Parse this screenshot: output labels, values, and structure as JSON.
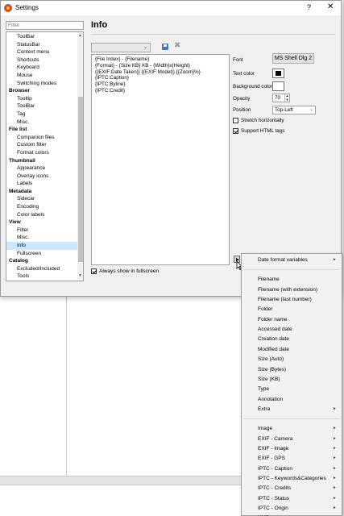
{
  "window": {
    "title": "Settings",
    "help_label": "?",
    "close_label": "✕"
  },
  "nav": {
    "filter_placeholder": "Filter",
    "items": [
      {
        "label": "ToolBar",
        "type": "sub"
      },
      {
        "label": "StatusBar",
        "type": "sub"
      },
      {
        "label": "Context menu",
        "type": "sub"
      },
      {
        "label": "Shortcuts",
        "type": "sub"
      },
      {
        "label": "Keyboard",
        "type": "sub"
      },
      {
        "label": "Mouse",
        "type": "sub"
      },
      {
        "label": "Switching modes",
        "type": "sub"
      },
      {
        "label": "Browser",
        "type": "cat"
      },
      {
        "label": "Tooltip",
        "type": "sub"
      },
      {
        "label": "ToolBar",
        "type": "sub"
      },
      {
        "label": "Tag",
        "type": "sub"
      },
      {
        "label": "Misc.",
        "type": "sub"
      },
      {
        "label": "File list",
        "type": "cat"
      },
      {
        "label": "Companion files",
        "type": "sub"
      },
      {
        "label": "Custom filter",
        "type": "sub"
      },
      {
        "label": "Format colors",
        "type": "sub"
      },
      {
        "label": "Thumbnail",
        "type": "cat"
      },
      {
        "label": "Appearance",
        "type": "sub"
      },
      {
        "label": "Overlay icons",
        "type": "sub"
      },
      {
        "label": "Labels",
        "type": "sub"
      },
      {
        "label": "Metadata",
        "type": "cat"
      },
      {
        "label": "Sidecar",
        "type": "sub"
      },
      {
        "label": "Encoding",
        "type": "sub"
      },
      {
        "label": "Color labels",
        "type": "sub"
      },
      {
        "label": "View",
        "type": "cat"
      },
      {
        "label": "Filter",
        "type": "sub"
      },
      {
        "label": "Misc.",
        "type": "sub"
      },
      {
        "label": "Info",
        "type": "sub",
        "selected": true
      },
      {
        "label": "Fullscreen",
        "type": "sub"
      },
      {
        "label": "Catalog",
        "type": "cat"
      },
      {
        "label": "Excluded/Included",
        "type": "sub"
      },
      {
        "label": "Tools",
        "type": "sub"
      }
    ]
  },
  "panel": {
    "title": "Info",
    "template_lines": [
      "{File Index} - {Filename}",
      "{Format} - {Size KB} KB - {Width}x{Height}",
      "{{EXIF:Date Taken}} {{EXIF:Model}} {{Zoom}%}",
      "{IPTC:Caption}",
      "{IPTC:Byline}",
      "{IPTC:Credit}"
    ],
    "always_fullscreen_label": "Always show in fullscreen",
    "always_fullscreen_checked": true,
    "font_label": "Font",
    "font_value": "MS Shell Dlg 2",
    "text_color_label": "Text color",
    "text_color": "#000000",
    "background_color_label": "Background color",
    "background_color": "#ffffff",
    "opacity_label": "Opacity",
    "opacity_value": "70",
    "position_label": "Position",
    "position_value": "Top-Left",
    "stretch_label": "Stretch horizontally",
    "stretch_checked": false,
    "html_label": "Support HTML tags",
    "html_checked": true
  },
  "context_menu": {
    "items": [
      {
        "label": "Date format variables",
        "submenu": true
      },
      {
        "separator": true
      },
      {
        "label": "Filename"
      },
      {
        "label": "Filename (with extension)"
      },
      {
        "label": "Filename (last number)"
      },
      {
        "label": "Folder"
      },
      {
        "label": "Folder name"
      },
      {
        "label": "Accessed date"
      },
      {
        "label": "Creation date"
      },
      {
        "label": "Modified date"
      },
      {
        "label": "Size (Auto)"
      },
      {
        "label": "Size (Bytes)"
      },
      {
        "label": "Size (KB)"
      },
      {
        "label": "Type"
      },
      {
        "label": "Annotation"
      },
      {
        "label": "Extra",
        "submenu": true
      },
      {
        "separator": true
      },
      {
        "label": "Image",
        "submenu": true
      },
      {
        "label": "EXIF - Camera",
        "submenu": true
      },
      {
        "label": "EXIF - Image",
        "submenu": true
      },
      {
        "label": "EXIF - GPS",
        "submenu": true
      },
      {
        "label": "IPTC - Caption",
        "submenu": true
      },
      {
        "label": "IPTC - Keywords&Categories",
        "submenu": true
      },
      {
        "label": "IPTC - Credits",
        "submenu": true
      },
      {
        "label": "IPTC - Status",
        "submenu": true
      },
      {
        "label": "IPTC - Origin",
        "submenu": true
      },
      {
        "label": "XMP",
        "submenu": true
      }
    ]
  }
}
